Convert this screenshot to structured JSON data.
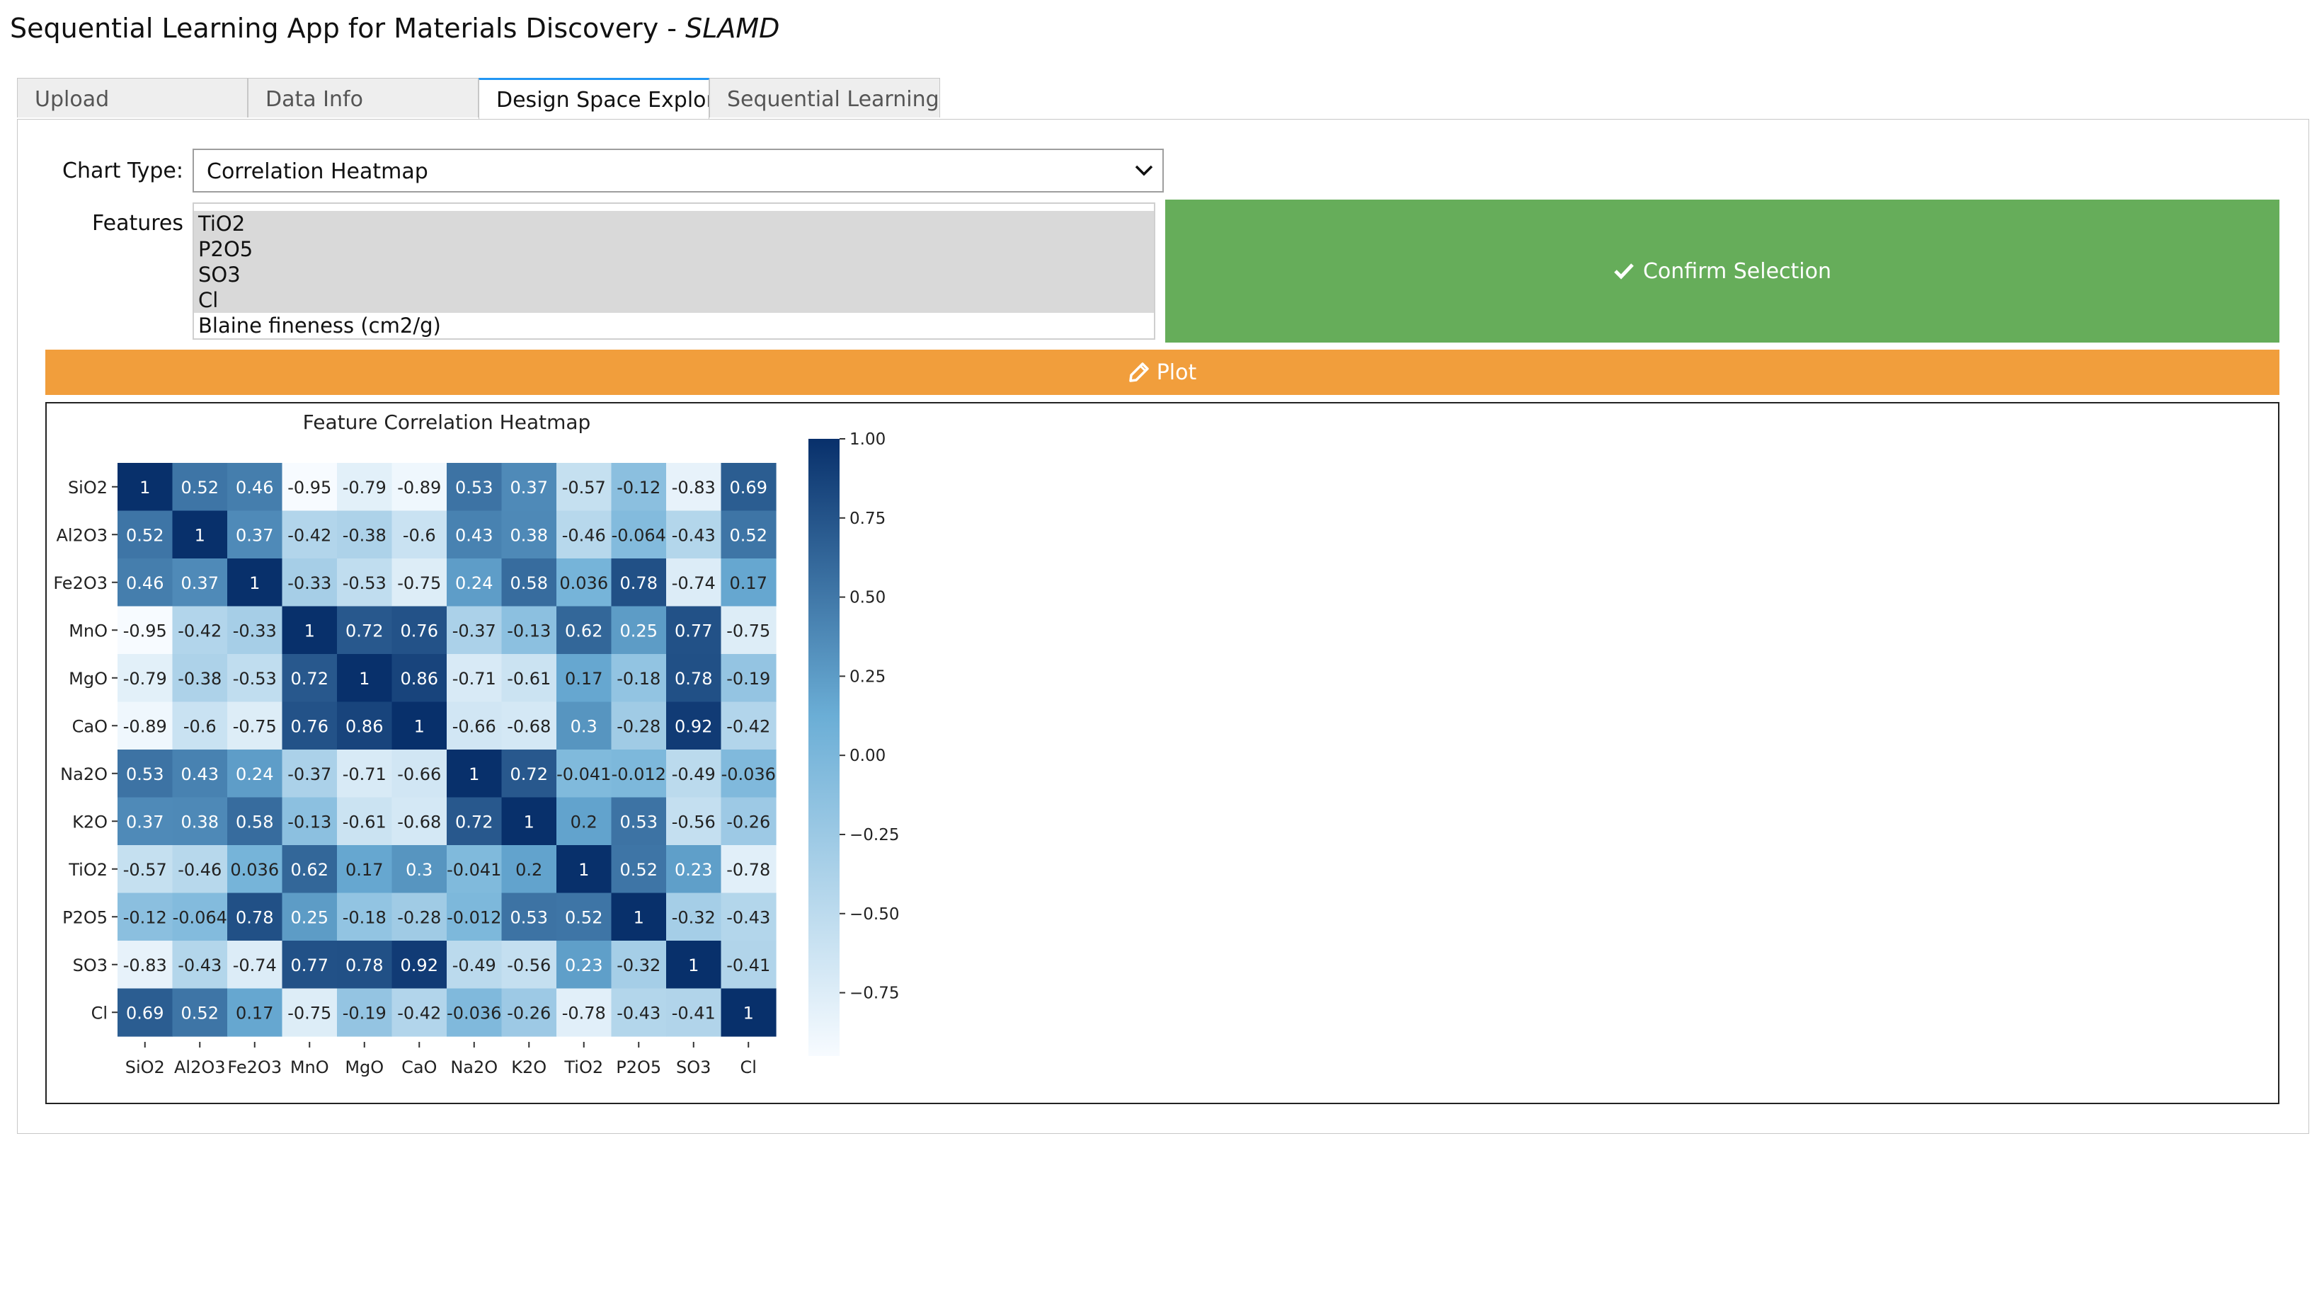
{
  "app": {
    "title_main": "Sequential Learning App for Materials Discovery - ",
    "title_abbr": "SLAMD"
  },
  "tabs": [
    {
      "label": "Upload"
    },
    {
      "label": "Data Info"
    },
    {
      "label": "Design Space Explor"
    },
    {
      "label": "Sequential Learning"
    }
  ],
  "form": {
    "chart_type_label": "Chart Type:",
    "chart_type_value": "Correlation Heatmap",
    "features_label": "Features",
    "features_options": [
      "TiO2",
      "P2O5",
      "SO3",
      "Cl",
      "Blaine fineness (cm2/g)"
    ],
    "features_selected": [
      true,
      true,
      true,
      true,
      false
    ],
    "confirm_label": "Confirm Selection",
    "plot_label": "Plot"
  },
  "colors": {
    "confirm": "#66ad5a",
    "plot": "#f19e3c",
    "tab_active": "#2196f3"
  },
  "icons": {
    "confirm": "check-icon",
    "plot": "pencil-icon",
    "dropdown": "chevron-down-icon"
  },
  "chart_data": {
    "type": "heatmap",
    "title": "Feature Correlation Heatmap",
    "labels": [
      "SiO2",
      "Al2O3",
      "Fe2O3",
      "MnO",
      "MgO",
      "CaO",
      "Na2O",
      "K2O",
      "TiO2",
      "P2O5",
      "SO3",
      "Cl"
    ],
    "matrix": [
      [
        1,
        0.52,
        0.46,
        -0.95,
        -0.79,
        -0.89,
        0.53,
        0.37,
        -0.57,
        -0.12,
        -0.83,
        0.69
      ],
      [
        0.52,
        1,
        0.37,
        -0.42,
        -0.38,
        -0.6,
        0.43,
        0.38,
        -0.46,
        -0.064,
        -0.43,
        0.52
      ],
      [
        0.46,
        0.37,
        1,
        -0.33,
        -0.53,
        -0.75,
        0.24,
        0.58,
        0.036,
        0.78,
        -0.74,
        0.17
      ],
      [
        -0.95,
        -0.42,
        -0.33,
        1,
        0.72,
        0.76,
        -0.37,
        -0.13,
        0.62,
        0.25,
        0.77,
        -0.75
      ],
      [
        -0.79,
        -0.38,
        -0.53,
        0.72,
        1,
        0.86,
        -0.71,
        -0.61,
        0.17,
        -0.18,
        0.78,
        -0.19
      ],
      [
        -0.89,
        -0.6,
        -0.75,
        0.76,
        0.86,
        1,
        -0.66,
        -0.68,
        0.3,
        -0.28,
        0.92,
        -0.42
      ],
      [
        0.53,
        0.43,
        0.24,
        -0.37,
        -0.71,
        -0.66,
        1,
        0.72,
        -0.041,
        -0.012,
        -0.49,
        -0.036
      ],
      [
        0.37,
        0.38,
        0.58,
        -0.13,
        -0.61,
        -0.68,
        0.72,
        1,
        0.2,
        0.53,
        -0.56,
        -0.26
      ],
      [
        -0.57,
        -0.46,
        0.036,
        0.62,
        0.17,
        0.3,
        -0.041,
        0.2,
        1,
        0.52,
        0.23,
        -0.78
      ],
      [
        -0.12,
        -0.064,
        0.78,
        0.25,
        -0.18,
        -0.28,
        -0.012,
        0.53,
        0.52,
        1,
        -0.32,
        -0.43
      ],
      [
        -0.83,
        -0.43,
        -0.74,
        0.77,
        0.78,
        0.92,
        -0.49,
        -0.56,
        0.23,
        -0.32,
        1,
        -0.41
      ],
      [
        0.69,
        0.52,
        0.17,
        -0.75,
        -0.19,
        -0.42,
        -0.036,
        -0.26,
        -0.78,
        -0.43,
        -0.41,
        1
      ]
    ],
    "colorbar": {
      "ticks": [
        1.0,
        0.75,
        0.5,
        0.25,
        0.0,
        -0.25,
        -0.5,
        -0.75
      ],
      "tick_labels": [
        "1.00",
        "0.75",
        "0.50",
        "0.25",
        "0.00",
        "−0.25",
        "−0.50",
        "−0.75"
      ],
      "vmin": -0.95,
      "vmax": 1.0,
      "colormap": "Blues",
      "color_low": "#f7fbff",
      "color_high": "#08306b"
    },
    "annotations": true
  }
}
